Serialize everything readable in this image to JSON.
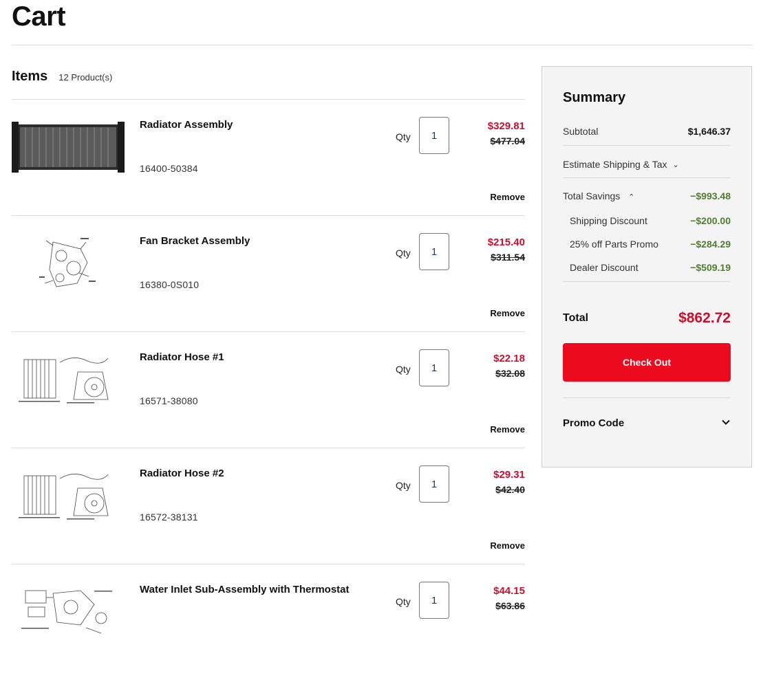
{
  "page": {
    "title": "Cart"
  },
  "items_header": {
    "title": "Items",
    "count": "12 Product(s)"
  },
  "item_common": {
    "qty_label": "Qty",
    "remove_label": "Remove"
  },
  "items": [
    {
      "name": "Radiator Assembly",
      "part_number": "16400-50384",
      "qty": "1",
      "price": "$329.81",
      "original_price": "$477.04"
    },
    {
      "name": "Fan Bracket Assembly",
      "part_number": "16380-0S010",
      "qty": "1",
      "price": "$215.40",
      "original_price": "$311.54"
    },
    {
      "name": "Radiator Hose #1",
      "part_number": "16571-38080",
      "qty": "1",
      "price": "$22.18",
      "original_price": "$32.08"
    },
    {
      "name": "Radiator Hose #2",
      "part_number": "16572-38131",
      "qty": "1",
      "price": "$29.31",
      "original_price": "$42.40"
    },
    {
      "name": "Water Inlet Sub-Assembly with Thermostat",
      "part_number": "",
      "qty": "1",
      "price": "$44.15",
      "original_price": "$63.86"
    }
  ],
  "summary": {
    "title": "Summary",
    "subtotal_label": "Subtotal",
    "subtotal_value": "$1,646.37",
    "shipping_label": "Estimate Shipping & Tax",
    "savings_label": "Total Savings",
    "savings_value": "−$993.48",
    "discounts": [
      {
        "label": "Shipping Discount",
        "value": "−$200.00"
      },
      {
        "label": "25% off Parts Promo",
        "value": "−$284.29"
      },
      {
        "label": "Dealer Discount",
        "value": "−$509.19"
      }
    ],
    "total_label": "Total",
    "total_value": "$862.72",
    "checkout_label": "Check Out",
    "promo_label": "Promo Code"
  },
  "colors": {
    "accent_red": "#eb0a1e",
    "price_red": "#c8102e",
    "savings_green": "#4e7d2c"
  }
}
